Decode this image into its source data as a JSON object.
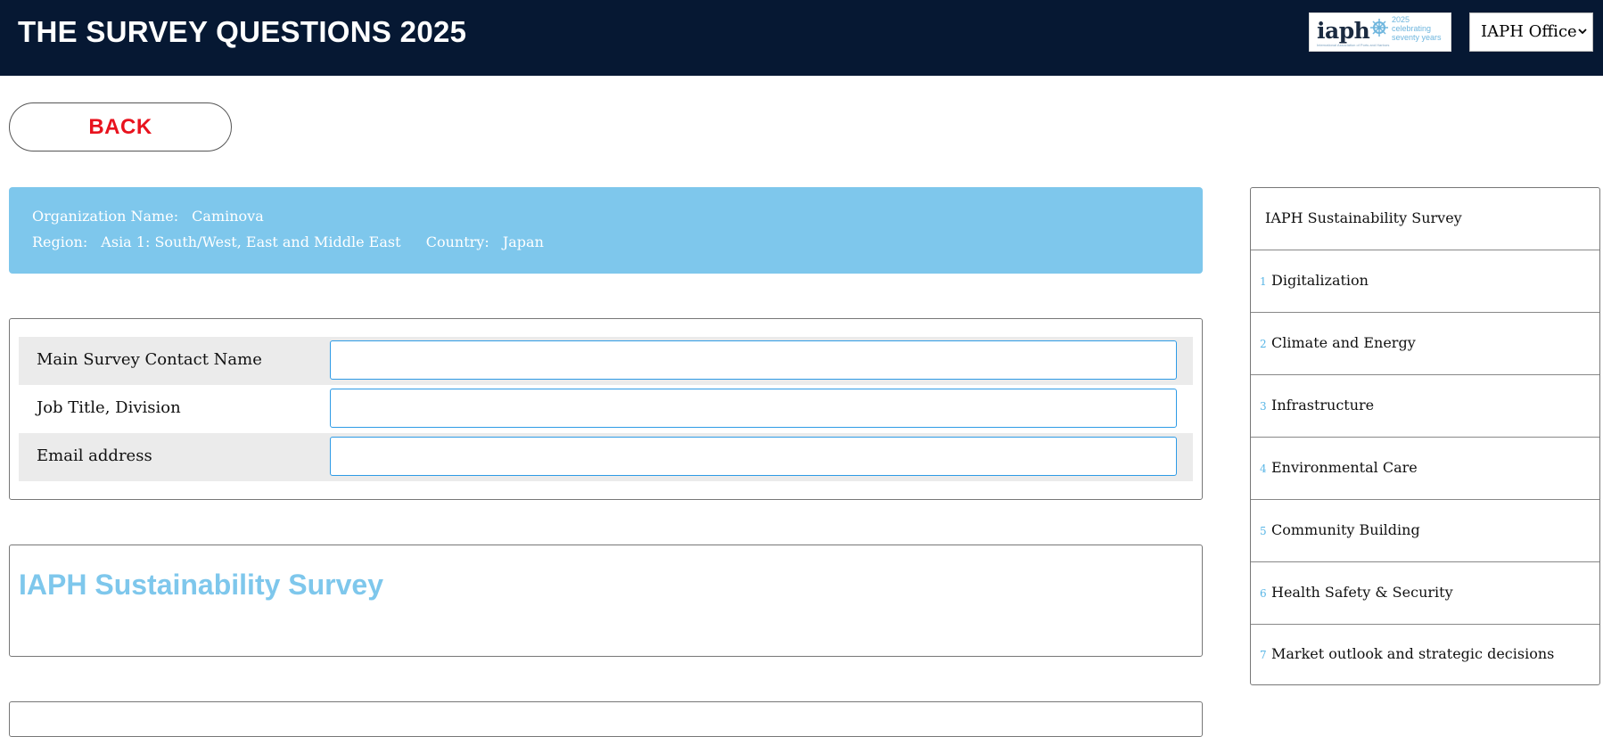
{
  "header": {
    "title": "THE SURVEY QUESTIONS 2025",
    "logo": {
      "mark": "iaph",
      "year": "2025",
      "tagline1": "celebrating",
      "tagline2": "seventy years",
      "fine_print": "International Association of Ports and Harbors"
    },
    "office_select": {
      "value": "IAPH Office"
    }
  },
  "back_button": {
    "label": "BACK"
  },
  "org_info": {
    "org_label": "Organization Name:",
    "org_value": "Caminova",
    "region_label": "Region:",
    "region_value": "Asia 1: South/West, East and Middle East",
    "country_label": "Country:",
    "country_value": "Japan"
  },
  "contact_form": {
    "fields": [
      {
        "label": "Main Survey Contact Name",
        "value": ""
      },
      {
        "label": "Job Title, Division",
        "value": ""
      },
      {
        "label": "Email address",
        "value": ""
      }
    ]
  },
  "survey_section": {
    "heading": "IAPH Sustainability Survey"
  },
  "sidebar": {
    "title": "IAPH Sustainability Survey",
    "items": [
      {
        "num": "1",
        "label": "Digitalization"
      },
      {
        "num": "2",
        "label": "Climate and Energy"
      },
      {
        "num": "3",
        "label": "Infrastructure"
      },
      {
        "num": "4",
        "label": "Environmental Care"
      },
      {
        "num": "5",
        "label": "Community Building"
      },
      {
        "num": "6",
        "label": "Health Safety & Security"
      },
      {
        "num": "7",
        "label": "Market outlook and strategic decisions"
      }
    ]
  },
  "colors": {
    "header_bg": "#061833",
    "accent_blue": "#7ec7ec",
    "back_red": "#e8131e",
    "input_border": "#2e9be6"
  }
}
